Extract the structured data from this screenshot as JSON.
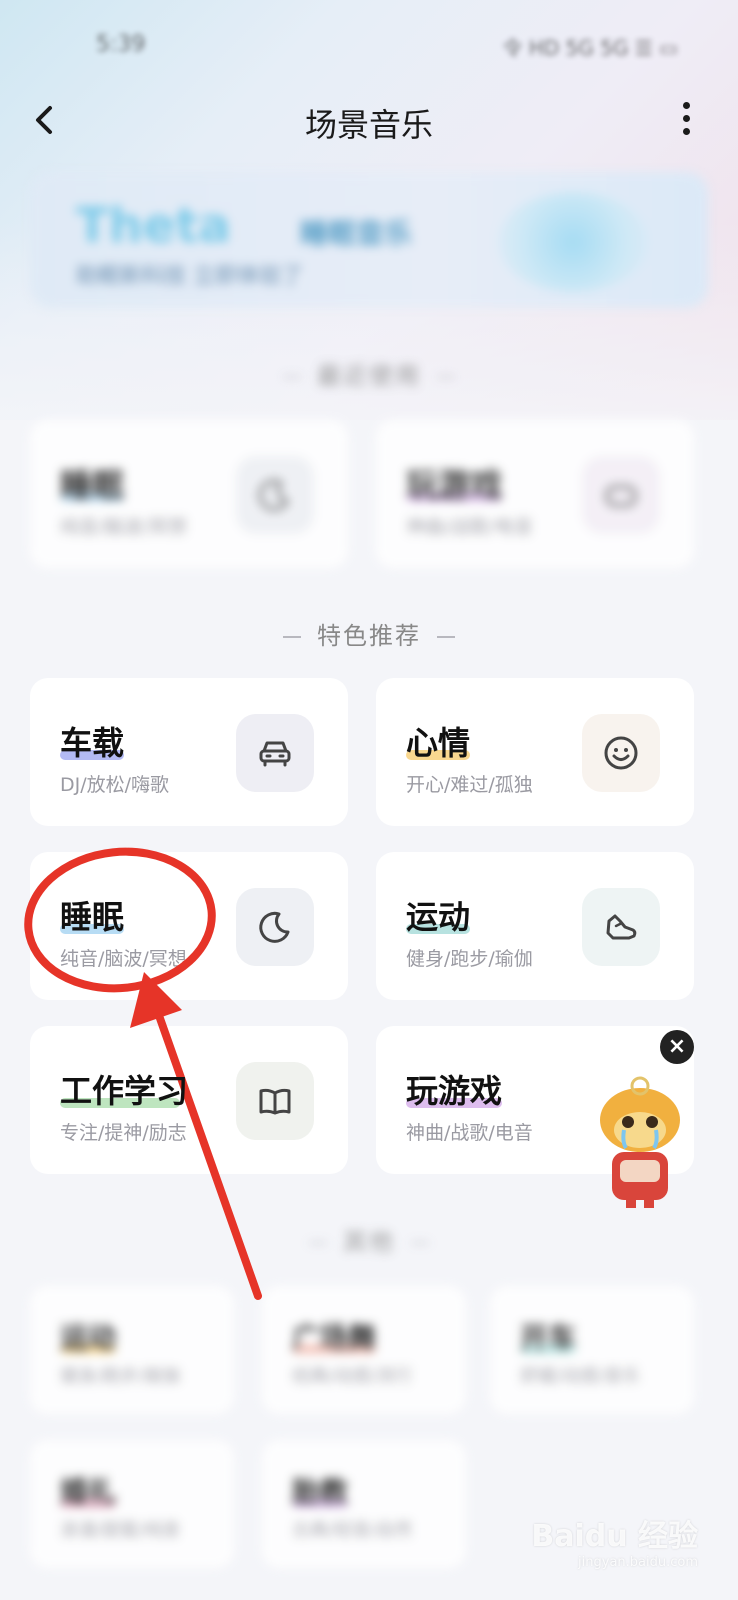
{
  "status_bar": {
    "time": "5:39",
    "icons": "令 HD 5G 5G ☰ ▭"
  },
  "nav": {
    "title": "场景音乐"
  },
  "banner": {
    "title": "Theta",
    "title2": "睡眠音乐",
    "subtitle": "助眠新科技 立即体验了"
  },
  "sections": {
    "recent": "最近使用",
    "featured": "特色推荐",
    "other": "其他"
  },
  "recent_cards": [
    {
      "title": "睡眠",
      "subtitle": "纯音/脑波/冥想",
      "icon": "moon-icon"
    },
    {
      "title": "玩游戏",
      "subtitle": "神曲/战歌/电音",
      "icon": "gamepad-icon"
    }
  ],
  "featured_cards": [
    {
      "title": "车载",
      "subtitle": "DJ/放松/嗨歌",
      "icon": "car-icon",
      "underline": "#9aa3f0",
      "icon_bg": "#eeeef4"
    },
    {
      "title": "心情",
      "subtitle": "开心/难过/孤独",
      "icon": "smiley-icon",
      "underline": "#f7c96a",
      "icon_bg": "#f8f3ee"
    },
    {
      "title": "睡眠",
      "subtitle": "纯音/脑波/冥想",
      "icon": "moon-icon",
      "underline": "#9fd0f0",
      "icon_bg": "#eef0f4"
    },
    {
      "title": "运动",
      "subtitle": "健身/跑步/瑜伽",
      "icon": "sneaker-icon",
      "underline": "#9fd8d6",
      "icon_bg": "#eef4f4"
    },
    {
      "title": "工作学习",
      "subtitle": "专注/提神/励志",
      "icon": "book-icon",
      "underline": "#a8dcaa",
      "icon_bg": "#f0f2ee"
    },
    {
      "title": "玩游戏",
      "subtitle": "神曲/战歌/电音",
      "icon": "gamepad-icon",
      "underline": "#d2a7e8",
      "icon_bg": "#f4eff6"
    }
  ],
  "other_cards": [
    {
      "title": "运动",
      "subtitle": "健身/跑步/瑜伽",
      "underline": "#f7c96a"
    },
    {
      "title": "广场舞",
      "subtitle": "经典/动感/流行",
      "underline": "#f0a99a"
    },
    {
      "title": "开车",
      "subtitle": "舒缓/动感/音乐",
      "underline": "#9fd8d6"
    },
    {
      "title": "婚礼",
      "subtitle": "浪漫/甜蜜/纯音",
      "underline": "#e59ab7"
    },
    {
      "title": "胎教",
      "subtitle": "古典/轻音/自然",
      "underline": "#d2a7e8"
    }
  ],
  "watermark": {
    "text": "Baidu 经验",
    "sub": "jingyan.baidu.com"
  },
  "colors": {
    "annotation": "#e63428",
    "background": "#f4f5f9"
  }
}
